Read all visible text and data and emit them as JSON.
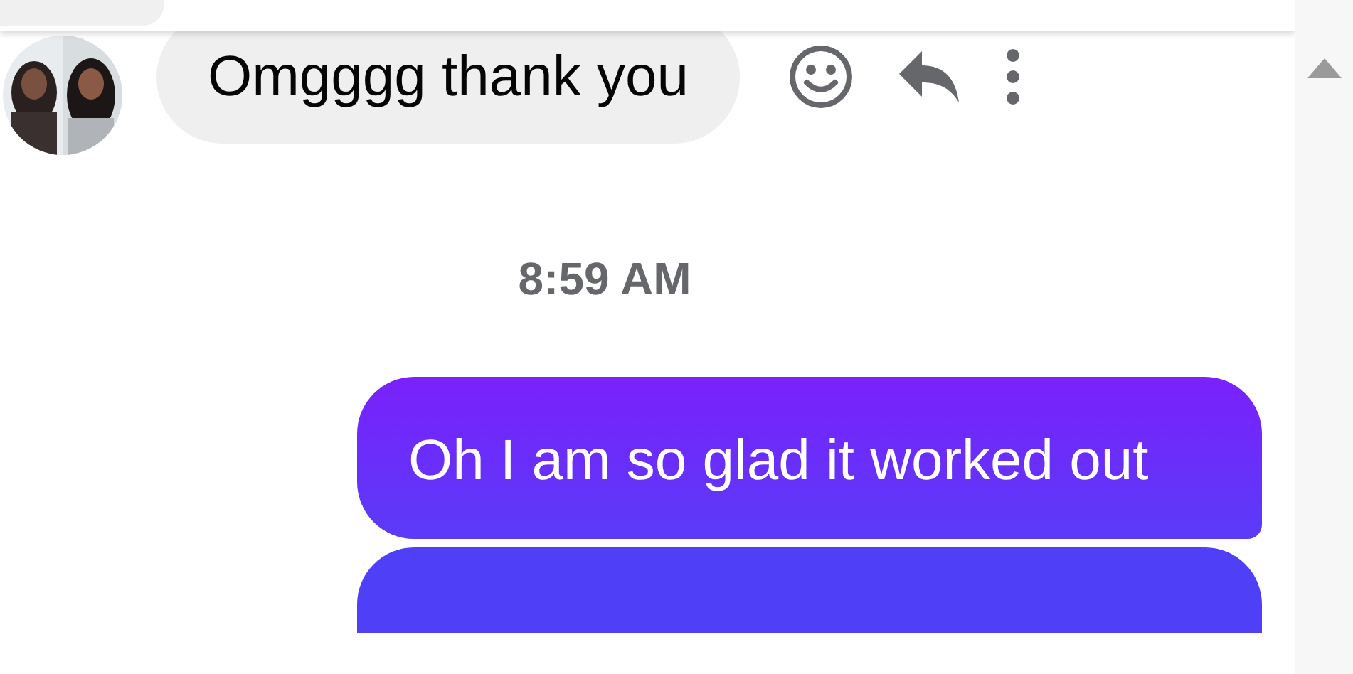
{
  "messages": [
    {
      "kind": "received",
      "text": "Omgggg thank you"
    },
    {
      "kind": "time",
      "text": "8:59 AM"
    },
    {
      "kind": "sent",
      "text": "Oh I am so glad it worked out"
    },
    {
      "kind": "sent"
    }
  ]
}
